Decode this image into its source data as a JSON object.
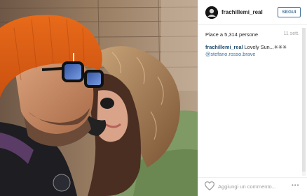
{
  "post": {
    "username": "frachillemi_real",
    "follow_label": "SEGUI",
    "likes_text": "Piace a 5,314 persone",
    "date_text": "11 sett.",
    "caption": {
      "user": "frachillemi_real",
      "text": "Lovely Sun...✳✳✳",
      "mention": "@stefano.rosso.brave"
    }
  },
  "comment": {
    "placeholder": "Aggiungi un commento...",
    "more_label": "•••"
  },
  "icons": {
    "avatar": "avatar",
    "heart": "heart-icon",
    "more": "more-options-icon"
  },
  "colors": {
    "link_blue": "#3f729b",
    "username_blue": "#1e4a6e",
    "text": "#262626",
    "muted": "#a5a5a5",
    "border": "#efefef"
  }
}
